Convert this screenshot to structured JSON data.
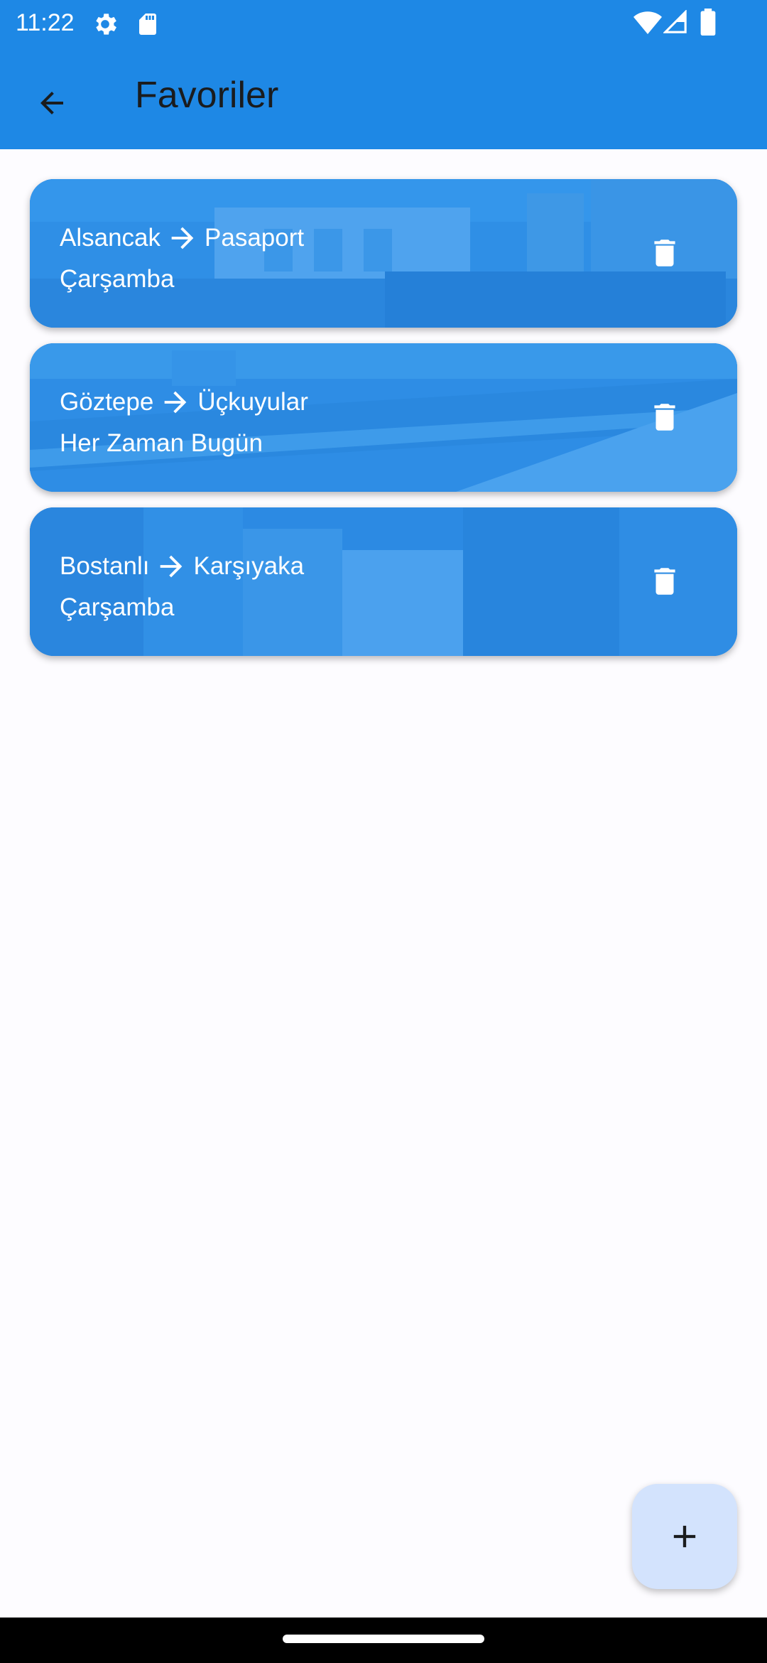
{
  "status_bar": {
    "time": "11:22",
    "icons": [
      "settings-icon",
      "sd-card-icon",
      "wifi-icon",
      "signal-icon",
      "battery-icon"
    ]
  },
  "app_bar": {
    "title": "Favoriler",
    "back_icon": "arrow-left-icon",
    "background": "#1E88E5"
  },
  "favorites": [
    {
      "from": "Alsancak",
      "to": "Pasaport",
      "day": "Çarşamba"
    },
    {
      "from": "Göztepe",
      "to": "Üçkuyular",
      "day": "Her Zaman Bugün"
    },
    {
      "from": "Bostanlı",
      "to": "Karşıyaka",
      "day": "Çarşamba"
    }
  ],
  "icons": {
    "route_arrow": "arrow-right-icon",
    "delete": "trash-icon",
    "add": "plus-icon"
  },
  "colors": {
    "accent": "#1E88E5",
    "card": "#2C8EE8",
    "fab": "#D3E3FD",
    "background": "#FDFCFF"
  }
}
